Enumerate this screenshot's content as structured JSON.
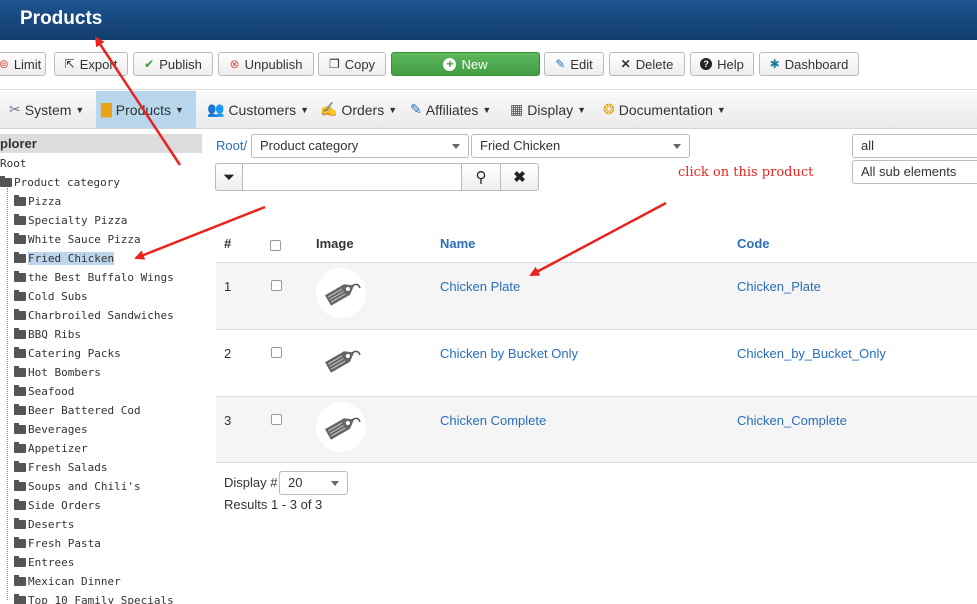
{
  "header": {
    "title": "Products"
  },
  "toolbar": {
    "buttons": [
      {
        "label": "Limit",
        "icon": "limit-icon"
      },
      {
        "label": "Export",
        "icon": "export-icon"
      },
      {
        "label": "Publish",
        "icon": "check-icon"
      },
      {
        "label": "Unpublish",
        "icon": "x-circle-icon"
      },
      {
        "label": "Copy",
        "icon": "copy-icon"
      },
      {
        "label": "New",
        "icon": "plus-icon"
      },
      {
        "label": "Edit",
        "icon": "edit-icon"
      },
      {
        "label": "Delete",
        "icon": "x-icon"
      },
      {
        "label": "Help",
        "icon": "help-icon"
      },
      {
        "label": "Dashboard",
        "icon": "dashboard-icon"
      }
    ]
  },
  "menu": {
    "items": [
      {
        "label": "System",
        "icon": "wrench-icon"
      },
      {
        "label": "Products",
        "icon": "box-icon"
      },
      {
        "label": "Customers",
        "icon": "users-icon"
      },
      {
        "label": "Orders",
        "icon": "orders-icon"
      },
      {
        "label": "Affiliates",
        "icon": "affiliates-icon"
      },
      {
        "label": "Display",
        "icon": "display-icon"
      },
      {
        "label": "Documentation",
        "icon": "documentation-icon"
      }
    ]
  },
  "sidebar": {
    "header": "plorer",
    "root": "Root",
    "category": "Product category",
    "items": [
      "Pizza",
      "Specialty Pizza",
      "White Sauce Pizza",
      "Fried Chicken",
      "the Best Buffalo Wings",
      "Cold Subs",
      "Charbroiled Sandwiches",
      "BBQ Ribs",
      "Catering Packs",
      "Hot Bombers",
      "Seafood",
      "Beer Battered Cod",
      "Beverages",
      "Appetizer",
      "Fresh Salads",
      "Soups and Chili's",
      "Side Orders",
      "Deserts",
      "Fresh Pasta",
      "Entrees",
      "Mexican Dinner",
      "Top 10 Family Specials"
    ],
    "selected": "Fried Chicken"
  },
  "filters": {
    "breadcrumb": "Root/",
    "type_select": "Product category",
    "category_select": "Fried Chicken",
    "status_select": "all",
    "scope_select": "All sub elements",
    "search_value": ""
  },
  "annotation": "click on this product",
  "table": {
    "headers": {
      "num": "#",
      "image": "Image",
      "name": "Name",
      "code": "Code"
    },
    "rows": [
      {
        "num": "1",
        "name": "Chicken Plate",
        "code": "Chicken_Plate"
      },
      {
        "num": "2",
        "name": "Chicken by Bucket Only",
        "code": "Chicken_by_Bucket_Only"
      },
      {
        "num": "3",
        "name": "Chicken Complete",
        "code": "Chicken_Complete"
      }
    ]
  },
  "footer": {
    "display_label": "Display #",
    "display_value": "20",
    "results": "Results 1 - 3 of 3"
  },
  "colors": {
    "header": "#174a80",
    "link": "#2a6ebb",
    "annotation": "#e8231f",
    "new_button": "#5cb85c"
  }
}
